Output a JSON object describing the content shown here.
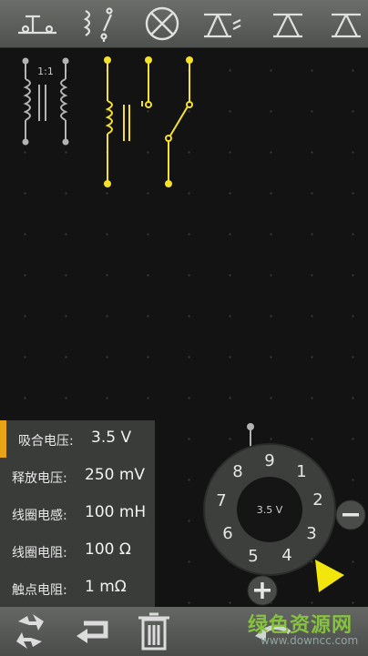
{
  "toolbar": {
    "items": [
      {
        "icon": "push-switch-icon"
      },
      {
        "icon": "relay-icon"
      },
      {
        "icon": "lamp-icon"
      },
      {
        "icon": "phototransistor-icon"
      },
      {
        "icon": "transistor-npn-icon"
      },
      {
        "icon": "transistor-pnp-icon"
      }
    ]
  },
  "canvas": {
    "transformer_ratio": "1:1"
  },
  "properties": {
    "rows": [
      {
        "label": "吸合电压:",
        "value": "3.5 V",
        "selected": true
      },
      {
        "label": "释放电压:",
        "value": "250 mV",
        "selected": false
      },
      {
        "label": "线圈电感:",
        "value": "100 mH",
        "selected": false
      },
      {
        "label": "线圈电阻:",
        "value": "100 Ω",
        "selected": false
      },
      {
        "label": "触点电阻:",
        "value": "1 mΩ",
        "selected": false
      }
    ]
  },
  "dial": {
    "center_value": "3.5 V",
    "numbers": [
      "1",
      "2",
      "3",
      "4",
      "5",
      "6",
      "7",
      "8",
      "9"
    ],
    "minus_label": "−",
    "plus_label": "+"
  },
  "bottom": {
    "buttons": [
      {
        "icon": "rotate-icon"
      },
      {
        "icon": "flip-icon"
      },
      {
        "icon": "trash-icon"
      },
      {
        "icon": "undo-icon"
      }
    ]
  },
  "watermark": {
    "main": "绿色资源网",
    "sub": "www.downcc.com"
  },
  "colors": {
    "accent": "#e8a317",
    "selected_wire": "#f5e12a",
    "component_gray": "#b8b8b8",
    "background": "#121312"
  }
}
